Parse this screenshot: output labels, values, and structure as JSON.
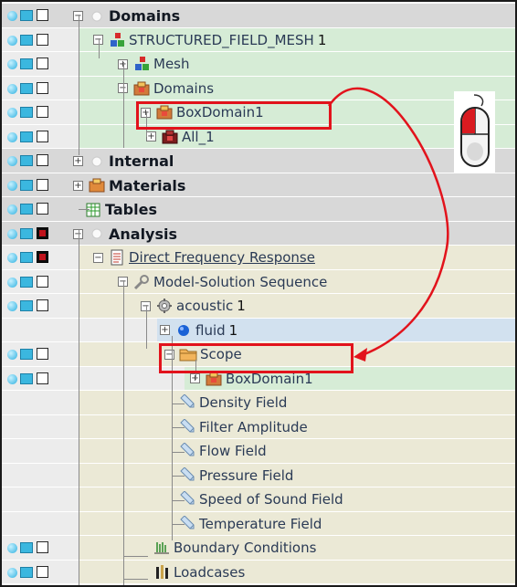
{
  "tree": {
    "rows": [
      {
        "label": "Domains",
        "bold": true,
        "expander": "⊖",
        "icon": "white-sphere-icon",
        "checkbox": "off"
      },
      {
        "label": "STRUCTURED_FIELD_MESH",
        "count": "1",
        "expander": "⊖",
        "icon": "mesh-blocks-icon",
        "checkbox": "off"
      },
      {
        "label": "Mesh",
        "expander": "⊕",
        "icon": "mesh-blocks-icon",
        "checkbox": "off"
      },
      {
        "label": "Domains",
        "expander": "⊖",
        "icon": "domain-box-icon",
        "checkbox": "off"
      },
      {
        "label": "BoxDomain1",
        "expander": "⊕",
        "icon": "domain-box-icon",
        "checkbox": "off"
      },
      {
        "label": "All_1",
        "expander": "⊕",
        "icon": "domain-box-dark-icon",
        "checkbox": "off"
      },
      {
        "label": "Internal",
        "bold": true,
        "expander": "⊕",
        "icon": "white-sphere-icon",
        "checkbox": "off"
      },
      {
        "label": "Materials",
        "bold": true,
        "expander": "⊕",
        "icon": "materials-icon",
        "checkbox": "off"
      },
      {
        "label": "Tables",
        "bold": true,
        "expander": "",
        "icon": "table-icon",
        "checkbox": "off"
      },
      {
        "label": "Analysis",
        "bold": true,
        "expander": "⊖",
        "icon": "white-sphere-icon",
        "checkbox": "on"
      },
      {
        "label": "Direct Frequency Response",
        "link": true,
        "expander": "⊖",
        "icon": "document-icon",
        "checkbox": "on"
      },
      {
        "label": "Model-Solution Sequence",
        "expander": "⊖",
        "icon": "wrench-icon",
        "checkbox": "off"
      },
      {
        "label": "acoustic",
        "count": "1",
        "expander": "⊖",
        "icon": "gear-icon",
        "checkbox": "off"
      },
      {
        "label": "fluid",
        "count": "1",
        "expander": "⊕",
        "icon": "blue-sphere-icon",
        "checkbox": ""
      },
      {
        "label": "Scope",
        "expander": "⊖",
        "icon": "folder-icon",
        "checkbox": "off"
      },
      {
        "label": "BoxDomain1",
        "expander": "⊕",
        "icon": "domain-box-icon",
        "checkbox": "off"
      },
      {
        "label": "Density Field",
        "expander": "",
        "icon": "field-pencil-icon",
        "checkbox": ""
      },
      {
        "label": "Filter Amplitude",
        "expander": "",
        "icon": "field-pencil-icon",
        "checkbox": ""
      },
      {
        "label": "Flow Field",
        "expander": "",
        "icon": "field-pencil-icon",
        "checkbox": ""
      },
      {
        "label": "Pressure Field",
        "expander": "",
        "icon": "field-pencil-icon",
        "checkbox": ""
      },
      {
        "label": "Speed of Sound Field",
        "expander": "",
        "icon": "field-pencil-icon",
        "checkbox": ""
      },
      {
        "label": "Temperature Field",
        "expander": "",
        "icon": "field-pencil-icon",
        "checkbox": ""
      },
      {
        "label": "Boundary Conditions",
        "expander": "",
        "icon": "boundary-conditions-icon",
        "checkbox": "off"
      },
      {
        "label": "Loadcases",
        "expander": "",
        "icon": "loadcases-icon",
        "checkbox": "off"
      }
    ]
  },
  "colors": {
    "section_gray": "#d8d8d8",
    "mesh_green": "#d6ecd6",
    "analysis_tan": "#ebe9d6",
    "fluid_blue": "#d2e1ef",
    "highlight_red": "#e2131c"
  },
  "annotation": {
    "arrow": "drag-arrow",
    "mouse_icon": "mouse-left-click-icon"
  }
}
